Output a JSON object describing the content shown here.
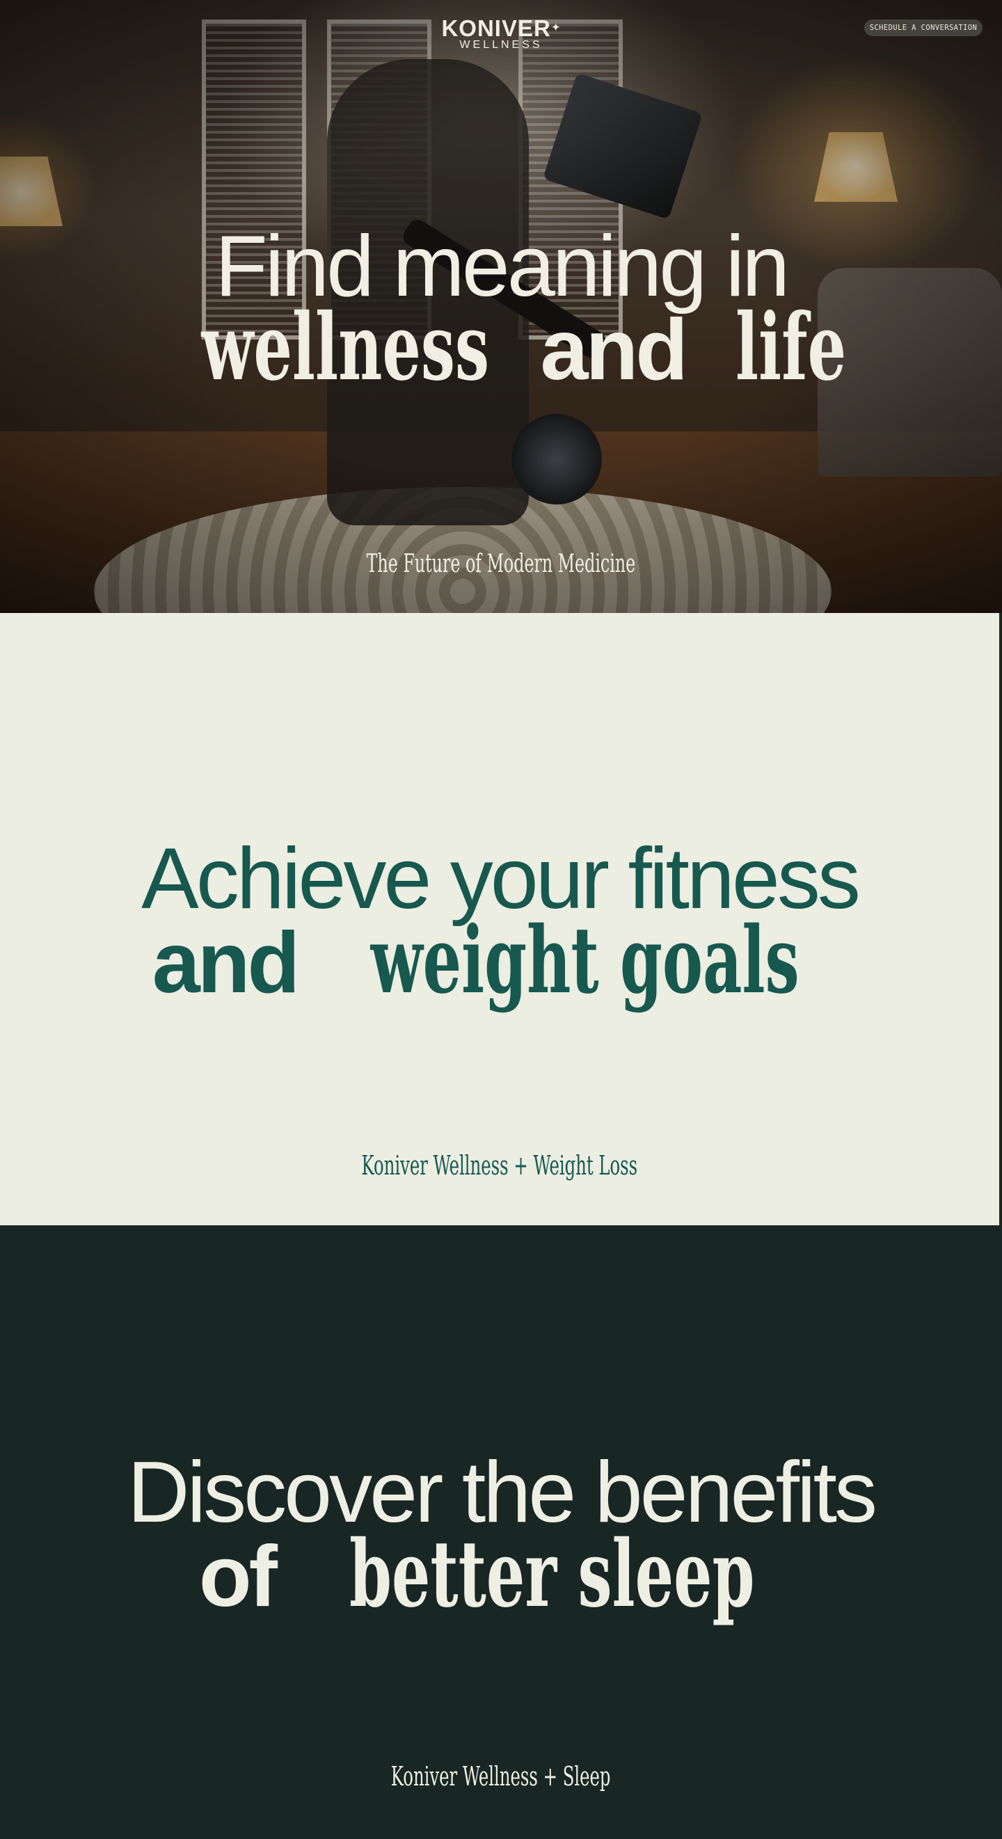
{
  "header": {
    "logo_main": "KONIVER",
    "logo_star": "✦",
    "logo_sub": "WELLNESS",
    "cta_label": "SCHEDULE A CONVERSATION"
  },
  "hero": {
    "line1": "Find meaning in",
    "line2_serif_a": "wellness",
    "line2_sans": "and",
    "line2_serif_b": "life",
    "subtitle": "The Future of Modern Medicine"
  },
  "fitness": {
    "line1": "Achieve your fitness",
    "line2_sans": "and",
    "line2_serif": "weight goals",
    "subtitle": "Koniver Wellness + Weight Loss",
    "bg_color": "#ebeee1",
    "text_color": "#17584f"
  },
  "sleep": {
    "line1": "Discover the benefits",
    "line2_sans": "of",
    "line2_serif": "better sleep",
    "subtitle": "Koniver Wellness + Sleep",
    "bg_color": "#182624",
    "text_color": "#eeefe3"
  }
}
